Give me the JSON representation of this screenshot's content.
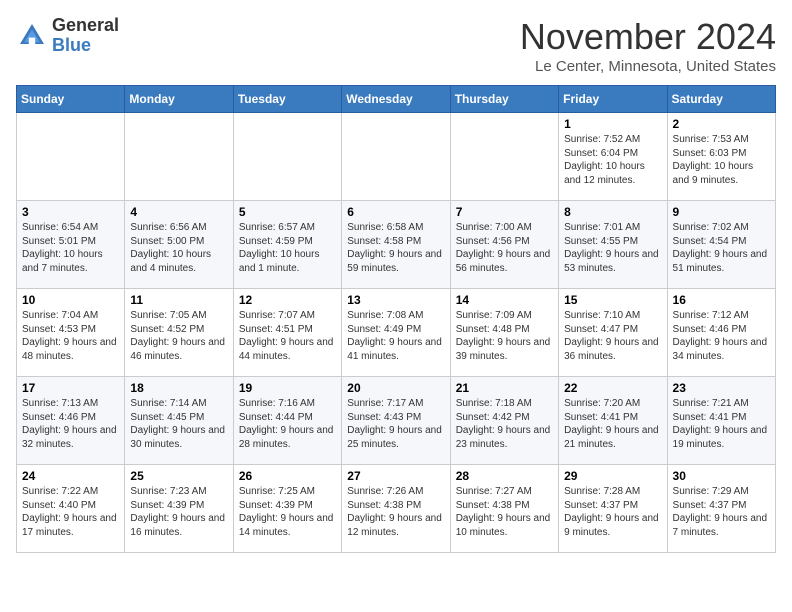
{
  "header": {
    "logo_general": "General",
    "logo_blue": "Blue",
    "month_title": "November 2024",
    "location": "Le Center, Minnesota, United States"
  },
  "weekdays": [
    "Sunday",
    "Monday",
    "Tuesday",
    "Wednesday",
    "Thursday",
    "Friday",
    "Saturday"
  ],
  "weeks": [
    [
      {
        "day": "",
        "info": ""
      },
      {
        "day": "",
        "info": ""
      },
      {
        "day": "",
        "info": ""
      },
      {
        "day": "",
        "info": ""
      },
      {
        "day": "",
        "info": ""
      },
      {
        "day": "1",
        "info": "Sunrise: 7:52 AM\nSunset: 6:04 PM\nDaylight: 10 hours and 12 minutes."
      },
      {
        "day": "2",
        "info": "Sunrise: 7:53 AM\nSunset: 6:03 PM\nDaylight: 10 hours and 9 minutes."
      }
    ],
    [
      {
        "day": "3",
        "info": "Sunrise: 6:54 AM\nSunset: 5:01 PM\nDaylight: 10 hours and 7 minutes."
      },
      {
        "day": "4",
        "info": "Sunrise: 6:56 AM\nSunset: 5:00 PM\nDaylight: 10 hours and 4 minutes."
      },
      {
        "day": "5",
        "info": "Sunrise: 6:57 AM\nSunset: 4:59 PM\nDaylight: 10 hours and 1 minute."
      },
      {
        "day": "6",
        "info": "Sunrise: 6:58 AM\nSunset: 4:58 PM\nDaylight: 9 hours and 59 minutes."
      },
      {
        "day": "7",
        "info": "Sunrise: 7:00 AM\nSunset: 4:56 PM\nDaylight: 9 hours and 56 minutes."
      },
      {
        "day": "8",
        "info": "Sunrise: 7:01 AM\nSunset: 4:55 PM\nDaylight: 9 hours and 53 minutes."
      },
      {
        "day": "9",
        "info": "Sunrise: 7:02 AM\nSunset: 4:54 PM\nDaylight: 9 hours and 51 minutes."
      }
    ],
    [
      {
        "day": "10",
        "info": "Sunrise: 7:04 AM\nSunset: 4:53 PM\nDaylight: 9 hours and 48 minutes."
      },
      {
        "day": "11",
        "info": "Sunrise: 7:05 AM\nSunset: 4:52 PM\nDaylight: 9 hours and 46 minutes."
      },
      {
        "day": "12",
        "info": "Sunrise: 7:07 AM\nSunset: 4:51 PM\nDaylight: 9 hours and 44 minutes."
      },
      {
        "day": "13",
        "info": "Sunrise: 7:08 AM\nSunset: 4:49 PM\nDaylight: 9 hours and 41 minutes."
      },
      {
        "day": "14",
        "info": "Sunrise: 7:09 AM\nSunset: 4:48 PM\nDaylight: 9 hours and 39 minutes."
      },
      {
        "day": "15",
        "info": "Sunrise: 7:10 AM\nSunset: 4:47 PM\nDaylight: 9 hours and 36 minutes."
      },
      {
        "day": "16",
        "info": "Sunrise: 7:12 AM\nSunset: 4:46 PM\nDaylight: 9 hours and 34 minutes."
      }
    ],
    [
      {
        "day": "17",
        "info": "Sunrise: 7:13 AM\nSunset: 4:46 PM\nDaylight: 9 hours and 32 minutes."
      },
      {
        "day": "18",
        "info": "Sunrise: 7:14 AM\nSunset: 4:45 PM\nDaylight: 9 hours and 30 minutes."
      },
      {
        "day": "19",
        "info": "Sunrise: 7:16 AM\nSunset: 4:44 PM\nDaylight: 9 hours and 28 minutes."
      },
      {
        "day": "20",
        "info": "Sunrise: 7:17 AM\nSunset: 4:43 PM\nDaylight: 9 hours and 25 minutes."
      },
      {
        "day": "21",
        "info": "Sunrise: 7:18 AM\nSunset: 4:42 PM\nDaylight: 9 hours and 23 minutes."
      },
      {
        "day": "22",
        "info": "Sunrise: 7:20 AM\nSunset: 4:41 PM\nDaylight: 9 hours and 21 minutes."
      },
      {
        "day": "23",
        "info": "Sunrise: 7:21 AM\nSunset: 4:41 PM\nDaylight: 9 hours and 19 minutes."
      }
    ],
    [
      {
        "day": "24",
        "info": "Sunrise: 7:22 AM\nSunset: 4:40 PM\nDaylight: 9 hours and 17 minutes."
      },
      {
        "day": "25",
        "info": "Sunrise: 7:23 AM\nSunset: 4:39 PM\nDaylight: 9 hours and 16 minutes."
      },
      {
        "day": "26",
        "info": "Sunrise: 7:25 AM\nSunset: 4:39 PM\nDaylight: 9 hours and 14 minutes."
      },
      {
        "day": "27",
        "info": "Sunrise: 7:26 AM\nSunset: 4:38 PM\nDaylight: 9 hours and 12 minutes."
      },
      {
        "day": "28",
        "info": "Sunrise: 7:27 AM\nSunset: 4:38 PM\nDaylight: 9 hours and 10 minutes."
      },
      {
        "day": "29",
        "info": "Sunrise: 7:28 AM\nSunset: 4:37 PM\nDaylight: 9 hours and 9 minutes."
      },
      {
        "day": "30",
        "info": "Sunrise: 7:29 AM\nSunset: 4:37 PM\nDaylight: 9 hours and 7 minutes."
      }
    ]
  ]
}
